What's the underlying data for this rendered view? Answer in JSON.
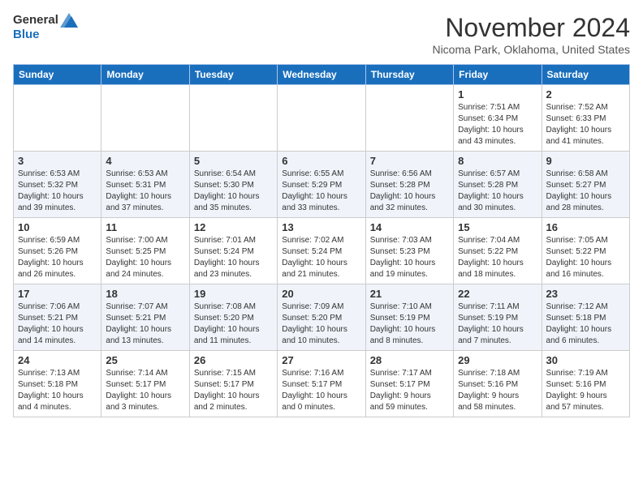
{
  "header": {
    "logo_general": "General",
    "logo_blue": "Blue",
    "month_title": "November 2024",
    "location": "Nicoma Park, Oklahoma, United States"
  },
  "weekdays": [
    "Sunday",
    "Monday",
    "Tuesday",
    "Wednesday",
    "Thursday",
    "Friday",
    "Saturday"
  ],
  "weeks": [
    [
      {
        "day": "",
        "info": ""
      },
      {
        "day": "",
        "info": ""
      },
      {
        "day": "",
        "info": ""
      },
      {
        "day": "",
        "info": ""
      },
      {
        "day": "",
        "info": ""
      },
      {
        "day": "1",
        "info": "Sunrise: 7:51 AM\nSunset: 6:34 PM\nDaylight: 10 hours\nand 43 minutes."
      },
      {
        "day": "2",
        "info": "Sunrise: 7:52 AM\nSunset: 6:33 PM\nDaylight: 10 hours\nand 41 minutes."
      }
    ],
    [
      {
        "day": "3",
        "info": "Sunrise: 6:53 AM\nSunset: 5:32 PM\nDaylight: 10 hours\nand 39 minutes."
      },
      {
        "day": "4",
        "info": "Sunrise: 6:53 AM\nSunset: 5:31 PM\nDaylight: 10 hours\nand 37 minutes."
      },
      {
        "day": "5",
        "info": "Sunrise: 6:54 AM\nSunset: 5:30 PM\nDaylight: 10 hours\nand 35 minutes."
      },
      {
        "day": "6",
        "info": "Sunrise: 6:55 AM\nSunset: 5:29 PM\nDaylight: 10 hours\nand 33 minutes."
      },
      {
        "day": "7",
        "info": "Sunrise: 6:56 AM\nSunset: 5:28 PM\nDaylight: 10 hours\nand 32 minutes."
      },
      {
        "day": "8",
        "info": "Sunrise: 6:57 AM\nSunset: 5:28 PM\nDaylight: 10 hours\nand 30 minutes."
      },
      {
        "day": "9",
        "info": "Sunrise: 6:58 AM\nSunset: 5:27 PM\nDaylight: 10 hours\nand 28 minutes."
      }
    ],
    [
      {
        "day": "10",
        "info": "Sunrise: 6:59 AM\nSunset: 5:26 PM\nDaylight: 10 hours\nand 26 minutes."
      },
      {
        "day": "11",
        "info": "Sunrise: 7:00 AM\nSunset: 5:25 PM\nDaylight: 10 hours\nand 24 minutes."
      },
      {
        "day": "12",
        "info": "Sunrise: 7:01 AM\nSunset: 5:24 PM\nDaylight: 10 hours\nand 23 minutes."
      },
      {
        "day": "13",
        "info": "Sunrise: 7:02 AM\nSunset: 5:24 PM\nDaylight: 10 hours\nand 21 minutes."
      },
      {
        "day": "14",
        "info": "Sunrise: 7:03 AM\nSunset: 5:23 PM\nDaylight: 10 hours\nand 19 minutes."
      },
      {
        "day": "15",
        "info": "Sunrise: 7:04 AM\nSunset: 5:22 PM\nDaylight: 10 hours\nand 18 minutes."
      },
      {
        "day": "16",
        "info": "Sunrise: 7:05 AM\nSunset: 5:22 PM\nDaylight: 10 hours\nand 16 minutes."
      }
    ],
    [
      {
        "day": "17",
        "info": "Sunrise: 7:06 AM\nSunset: 5:21 PM\nDaylight: 10 hours\nand 14 minutes."
      },
      {
        "day": "18",
        "info": "Sunrise: 7:07 AM\nSunset: 5:21 PM\nDaylight: 10 hours\nand 13 minutes."
      },
      {
        "day": "19",
        "info": "Sunrise: 7:08 AM\nSunset: 5:20 PM\nDaylight: 10 hours\nand 11 minutes."
      },
      {
        "day": "20",
        "info": "Sunrise: 7:09 AM\nSunset: 5:20 PM\nDaylight: 10 hours\nand 10 minutes."
      },
      {
        "day": "21",
        "info": "Sunrise: 7:10 AM\nSunset: 5:19 PM\nDaylight: 10 hours\nand 8 minutes."
      },
      {
        "day": "22",
        "info": "Sunrise: 7:11 AM\nSunset: 5:19 PM\nDaylight: 10 hours\nand 7 minutes."
      },
      {
        "day": "23",
        "info": "Sunrise: 7:12 AM\nSunset: 5:18 PM\nDaylight: 10 hours\nand 6 minutes."
      }
    ],
    [
      {
        "day": "24",
        "info": "Sunrise: 7:13 AM\nSunset: 5:18 PM\nDaylight: 10 hours\nand 4 minutes."
      },
      {
        "day": "25",
        "info": "Sunrise: 7:14 AM\nSunset: 5:17 PM\nDaylight: 10 hours\nand 3 minutes."
      },
      {
        "day": "26",
        "info": "Sunrise: 7:15 AM\nSunset: 5:17 PM\nDaylight: 10 hours\nand 2 minutes."
      },
      {
        "day": "27",
        "info": "Sunrise: 7:16 AM\nSunset: 5:17 PM\nDaylight: 10 hours\nand 0 minutes."
      },
      {
        "day": "28",
        "info": "Sunrise: 7:17 AM\nSunset: 5:17 PM\nDaylight: 9 hours\nand 59 minutes."
      },
      {
        "day": "29",
        "info": "Sunrise: 7:18 AM\nSunset: 5:16 PM\nDaylight: 9 hours\nand 58 minutes."
      },
      {
        "day": "30",
        "info": "Sunrise: 7:19 AM\nSunset: 5:16 PM\nDaylight: 9 hours\nand 57 minutes."
      }
    ]
  ]
}
